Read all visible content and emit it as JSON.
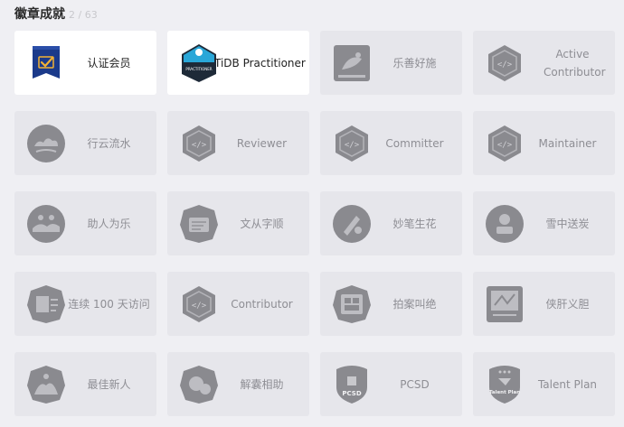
{
  "header": {
    "title": "徽章成就",
    "count": "2 / 63"
  },
  "colors": {
    "earned_bg": "#ffffff",
    "locked_bg": "#e6e6eb",
    "badge_gray": "#8a8a8f",
    "member_blue": "#1b3a8a",
    "member_gold": "#f2b134"
  },
  "badges": [
    {
      "label": "认证会员",
      "icon": "member-shield-icon",
      "earned": true
    },
    {
      "label": "TiDB Practitioner",
      "icon": "tidb-practitioner-icon",
      "earned": true,
      "icon_text": "PRACTITIONER"
    },
    {
      "label": "乐善好施",
      "icon": "charity-icon",
      "earned": false
    },
    {
      "label": "Active Contributor",
      "icon": "code-hexagon-icon",
      "earned": false
    },
    {
      "label": "行云流水",
      "icon": "clouds-icon",
      "earned": false
    },
    {
      "label": "Reviewer",
      "icon": "code-hexagon-icon",
      "earned": false
    },
    {
      "label": "Committer",
      "icon": "code-hexagon-icon",
      "earned": false
    },
    {
      "label": "Maintainer",
      "icon": "code-hexagon-icon",
      "earned": false
    },
    {
      "label": "助人为乐",
      "icon": "helping-icon",
      "earned": false
    },
    {
      "label": "文从字顺",
      "icon": "writing-icon",
      "earned": false
    },
    {
      "label": "妙笔生花",
      "icon": "pen-flower-icon",
      "earned": false
    },
    {
      "label": "雪中送炭",
      "icon": "snow-icon",
      "earned": false
    },
    {
      "label": "连续 100 天访问",
      "icon": "visit-100-icon",
      "earned": false
    },
    {
      "label": "Contributor",
      "icon": "code-hexagon-icon",
      "earned": false
    },
    {
      "label": "拍案叫绝",
      "icon": "applause-icon",
      "earned": false
    },
    {
      "label": "侠肝义胆",
      "icon": "hero-icon",
      "earned": false
    },
    {
      "label": "最佳新人",
      "icon": "newcomer-icon",
      "earned": false
    },
    {
      "label": "解囊相助",
      "icon": "donate-icon",
      "earned": false
    },
    {
      "label": "PCSD",
      "icon": "pcsd-shield-icon",
      "earned": false,
      "icon_text": "PCSD"
    },
    {
      "label": "Talent Plan",
      "icon": "talent-plan-shield-icon",
      "earned": false,
      "icon_text": "Talent Plan"
    }
  ]
}
